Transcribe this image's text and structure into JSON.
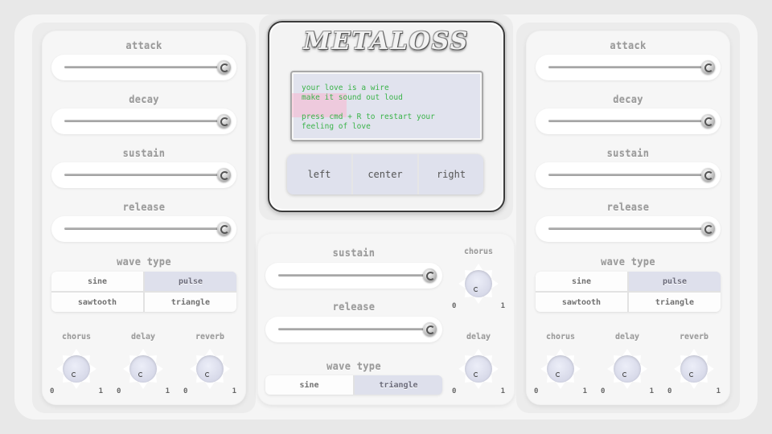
{
  "app": {
    "logo_text": "METALOSS"
  },
  "left_panel": {
    "sliders": [
      {
        "label": "attack",
        "value": 1.0
      },
      {
        "label": "decay",
        "value": 1.0
      },
      {
        "label": "sustain",
        "value": 1.0
      },
      {
        "label": "release",
        "value": 1.0
      }
    ],
    "wave_type": {
      "label": "wave type",
      "options": [
        "sine",
        "pulse",
        "sawtooth",
        "triangle"
      ],
      "selected": "pulse"
    },
    "knobs": [
      {
        "label": "chorus",
        "min": "0",
        "max": "1"
      },
      {
        "label": "delay",
        "min": "0",
        "max": "1"
      },
      {
        "label": "reverb",
        "min": "0",
        "max": "1"
      }
    ]
  },
  "display": {
    "lines": [
      "your love is a wire",
      "make it sound out loud",
      "",
      "press cmd + R to restart your",
      "feeling of love"
    ],
    "text_color": "#3bb34a",
    "buttons": [
      "left",
      "center",
      "right"
    ]
  },
  "center_panel": {
    "sliders": [
      {
        "label": "sustain",
        "value": 1.0
      },
      {
        "label": "release",
        "value": 1.0
      }
    ],
    "wave_type": {
      "label": "wave type",
      "options": [
        "sine",
        "triangle"
      ],
      "selected": "triangle"
    },
    "knobs": [
      {
        "label": "chorus",
        "min": "0",
        "max": "1"
      },
      {
        "label": "delay",
        "min": "0",
        "max": "1"
      }
    ]
  },
  "right_panel": {
    "sliders": [
      {
        "label": "attack",
        "value": 1.0
      },
      {
        "label": "decay",
        "value": 1.0
      },
      {
        "label": "sustain",
        "value": 1.0
      },
      {
        "label": "release",
        "value": 1.0
      }
    ],
    "wave_type": {
      "label": "wave type",
      "options": [
        "sine",
        "pulse",
        "sawtooth",
        "triangle"
      ],
      "selected": "pulse"
    },
    "knobs": [
      {
        "label": "chorus",
        "min": "0",
        "max": "1"
      },
      {
        "label": "delay",
        "min": "0",
        "max": "1"
      },
      {
        "label": "reverb",
        "min": "0",
        "max": "1"
      }
    ]
  },
  "colors": {
    "accent_selected": "#dee0ec",
    "screen_bg": "#e1e3ee",
    "highlight": "#ffaac8"
  }
}
